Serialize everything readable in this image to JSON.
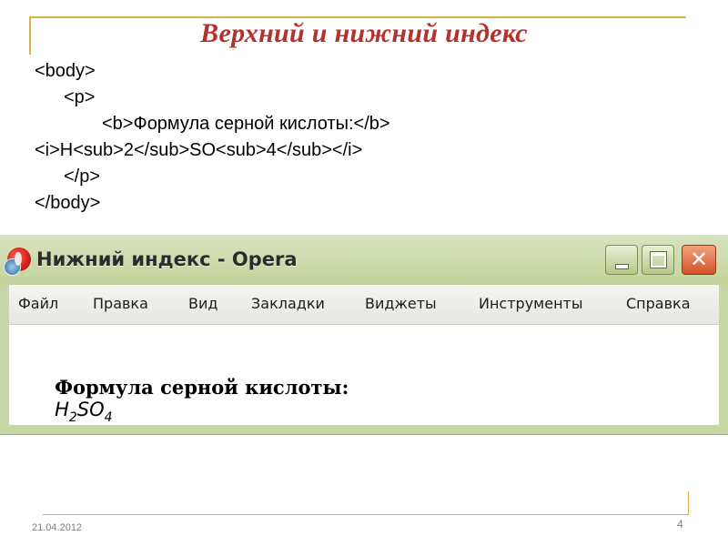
{
  "slide": {
    "title": "Верхний и нижний индекс",
    "code_lines": [
      "<body>",
      "<p>",
      "<b>Формула серной кислоты:</b>",
      "<i>H<sub>2</sub>SO<sub>4</sub></i>",
      "</p>",
      "</body>"
    ],
    "date": "21.04.2012",
    "page_number": "4"
  },
  "window": {
    "title": "Нижний индекс - Opera",
    "close_glyph": "✕",
    "menu": [
      "Файл",
      "Правка",
      "Вид",
      "Закладки",
      "Виджеты",
      "Инструменты",
      "Справка"
    ],
    "content": {
      "label": "Формула серной кислоты:",
      "formula_parts": [
        "H",
        "2",
        "SO",
        "4"
      ]
    }
  },
  "colors": {
    "title": "#b3322c",
    "frame_accent": "#d8b24a",
    "window_chrome": "#c7d6a5"
  }
}
